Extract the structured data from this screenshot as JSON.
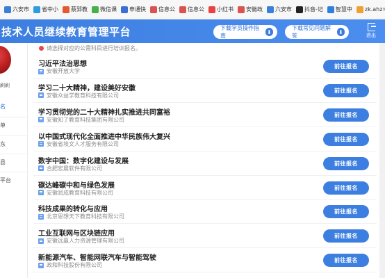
{
  "bookmarks": [
    {
      "label": "六安市",
      "color": "#3a7fd8"
    },
    {
      "label": "省中小",
      "color": "#2f9be0"
    },
    {
      "label": "蔡郢教",
      "color": "#e35b2d"
    },
    {
      "label": "微信课",
      "color": "#46b04a"
    },
    {
      "label": "申通快",
      "color": "#3d6fd2"
    },
    {
      "label": "信息公",
      "color": "#d9534f"
    },
    {
      "label": "信息公",
      "color": "#d9534f"
    },
    {
      "label": "小红书",
      "color": "#e94242"
    },
    {
      "label": "安徽政",
      "color": "#d9534f"
    },
    {
      "label": "六安市",
      "color": "#3a7fd8"
    },
    {
      "label": "抖音-记",
      "color": "#222222"
    },
    {
      "label": "智慧中",
      "color": "#2f7fe0"
    },
    {
      "label": "zk.ahz",
      "color": "#f0a030"
    }
  ],
  "header": {
    "title": "技术人员继续教育管理平台",
    "guide_button": "下载学员操作指南",
    "faq_button": "下载常见问题解答",
    "logout": "退出",
    "accent": "#3d7fe0"
  },
  "sidebar": {
    "user": "刷刷",
    "items": [
      "名",
      "单",
      "东",
      "县",
      "平台"
    ]
  },
  "notice": "请选择对应的公需科目进行培训报名。",
  "enroll_label": "前往报名",
  "courses": [
    {
      "title": "习近平法治思想",
      "org": "安徽开放大学"
    },
    {
      "title": "学习二十大精神，建设美好安徽",
      "org": "安徽众益学教育科技有限公司"
    },
    {
      "title": "学习贯彻党的二十大精神扎实推进共同富裕",
      "org": "安徽知了教育科技集团有限公司"
    },
    {
      "title": "以中国式现代化全面推进中华民族伟大复兴",
      "org": "安徽省埃文人才服务有限公司"
    },
    {
      "title": "数字中国：数字化建设与发展",
      "org": "合肥宏晨软件有限公司"
    },
    {
      "title": "碳达峰碳中和与绿色发展",
      "org": "安徽润成教育科技有限公司"
    },
    {
      "title": "科技成果的转化与应用",
      "org": "北京思想天下教育科技有限公司"
    },
    {
      "title": "工业互联网与区块链应用",
      "org": "安徽远赢人力资源管理有限公司"
    },
    {
      "title": "新能源汽车、智能网联汽车与智能驾驶",
      "org": "政和科技股份有限公司"
    }
  ]
}
